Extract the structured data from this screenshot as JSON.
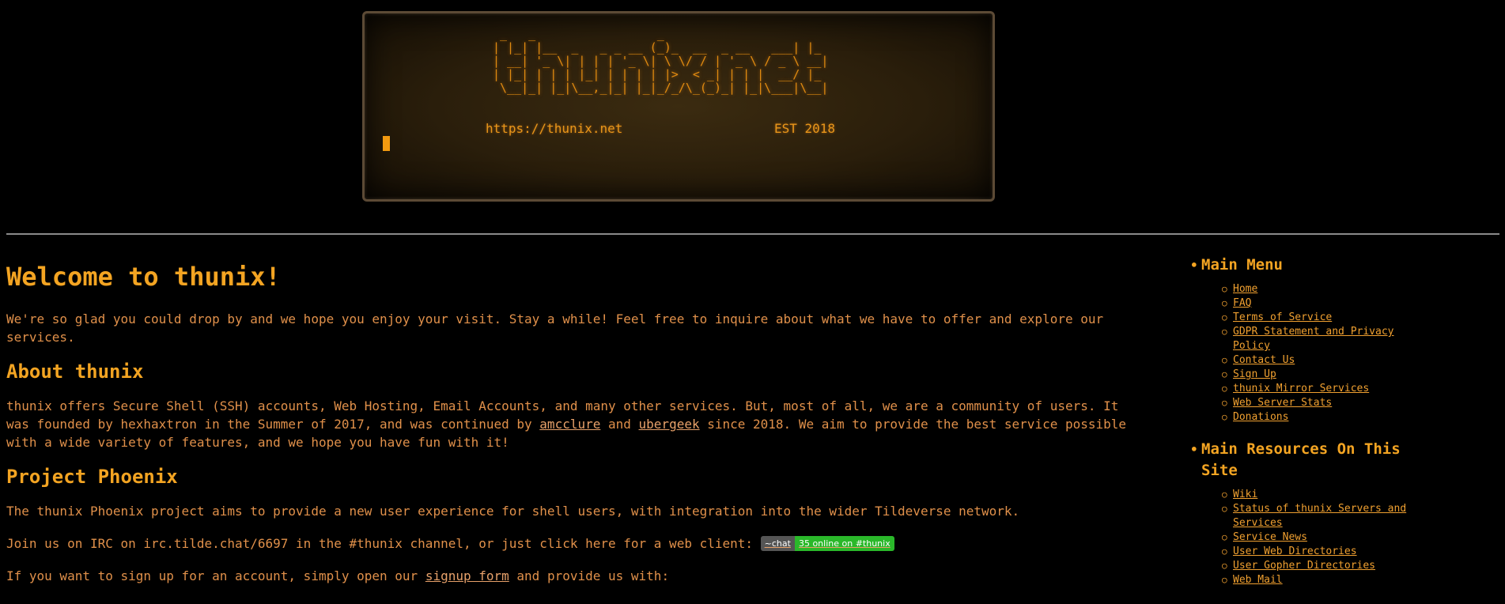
{
  "banner": {
    "ascii_art": " _   _                 _      \n| |_| |__  _   _ _ __ (_)_  __  _ __   ___| |_\n| __| '_ \\| | | | '_ \\| \\ \\/ / | '_ \\ / _ \\ __|\n| |_| | | | |_| | | | | |>  < _| | | |  __/ |_\n \\__|_| |_|\\__,_|_| |_|_/_/\\_(_)_| |_|\\___|\\__|",
    "url_text": "https://thunix.net",
    "est_text": "EST 2018"
  },
  "main": {
    "title": "Welcome to thunix!",
    "intro": "We're so glad you could drop by and we hope you enjoy your visit. Stay a while! Feel free to inquire about what we have to offer and explore our services.",
    "about": {
      "heading": "About thunix",
      "text_1": "thunix offers Secure Shell (SSH) accounts, Web Hosting, Email Accounts, and many other services. But, most of all, we are a community of users. It was founded by hexhaxtron in the Summer of 2017, and was continued by ",
      "link_1": "amcclure",
      "text_2": " and ",
      "link_2": "ubergeek",
      "text_3": " since 2018. We aim to provide the best service possible with a wide variety of features, and we hope you have fun with it!"
    },
    "phoenix": {
      "heading": "Project Phoenix",
      "text": "The thunix Phoenix project aims to provide a new user experience for shell users, with integration into the wider Tildeverse network.",
      "irc_text": "Join us on IRC on irc.tilde.chat/6697 in the #thunix channel, or just click here for a web client: ",
      "badge_left": "~chat",
      "badge_right": "35 online on #thunix",
      "signup_text_1": "If you want to sign up for an account, simply open our ",
      "signup_link": "signup form",
      "signup_text_2": " and provide us with:"
    }
  },
  "sidebar": {
    "main_menu": {
      "title": "Main Menu",
      "items": [
        "Home",
        "FAQ",
        "Terms of Service",
        "GDPR Statement and Privacy Policy",
        "Contact Us",
        "Sign Up",
        "thunix Mirror Services",
        "Web Server Stats",
        "Donations"
      ]
    },
    "resources": {
      "title": "Main Resources On This Site",
      "items": [
        "Wiki",
        "Status of thunix Servers and Services",
        "Service News",
        "User Web Directories",
        "User Gopher Directories",
        "Web Mail"
      ]
    }
  }
}
